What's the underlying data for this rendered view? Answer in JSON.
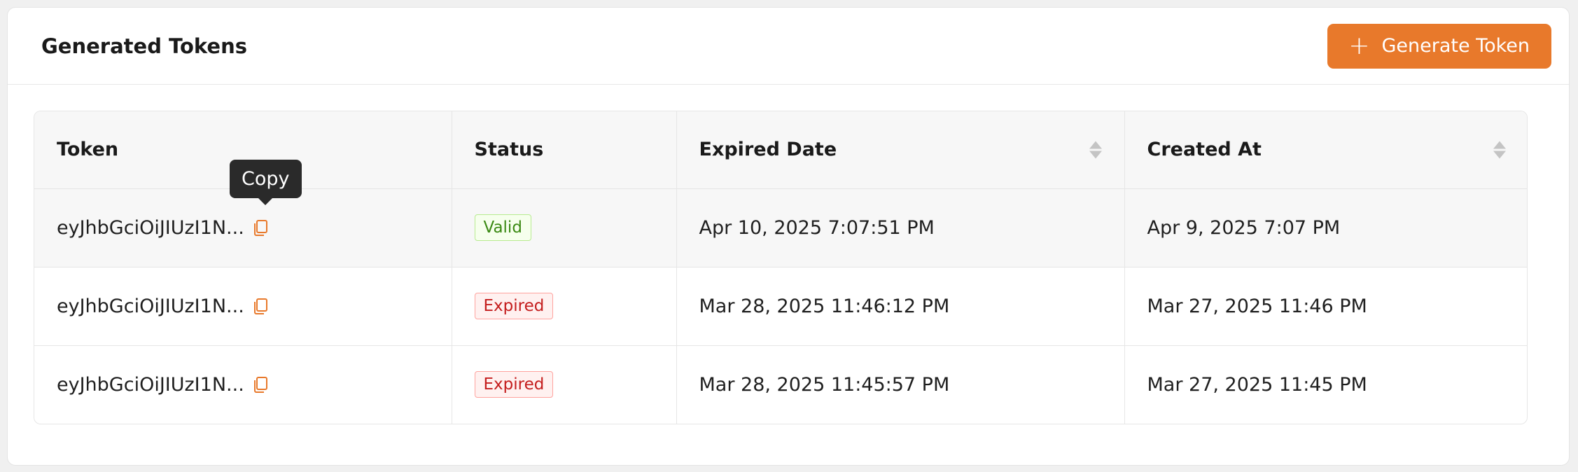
{
  "header": {
    "title": "Generated Tokens",
    "generate_button_label": "Generate Token"
  },
  "table": {
    "columns": {
      "token": "Token",
      "status": "Status",
      "expired_date": "Expired Date",
      "created_at": "Created At"
    },
    "rows": [
      {
        "token": "eyJhbGciOiJIUzI1N...",
        "status": "Valid",
        "expired_date": "Apr 10, 2025 7:07:51 PM",
        "created_at": "Apr 9, 2025 7:07 PM"
      },
      {
        "token": "eyJhbGciOiJIUzI1N...",
        "status": "Expired",
        "expired_date": "Mar 28, 2025 11:46:12 PM",
        "created_at": "Mar 27, 2025 11:46 PM"
      },
      {
        "token": "eyJhbGciOiJIUzI1N...",
        "status": "Expired",
        "expired_date": "Mar 28, 2025 11:45:57 PM",
        "created_at": "Mar 27, 2025 11:45 PM"
      }
    ]
  },
  "tooltip": {
    "text": "Copy"
  },
  "colors": {
    "accent": "#e8792b",
    "valid": "#3b8a14",
    "expired": "#c41d1d"
  },
  "icons": [
    "plus-icon",
    "copy-icon",
    "sort-icon"
  ]
}
